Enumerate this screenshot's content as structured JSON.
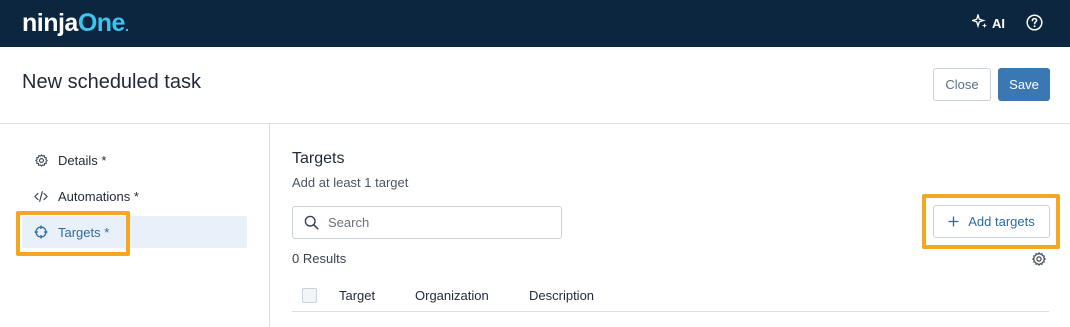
{
  "app": {
    "logo_part1": "ninja",
    "logo_part2": "One",
    "logo_dot": "."
  },
  "topbar": {
    "ai_label": "AI",
    "ai_icon": "sparkle-icon",
    "help_icon": "help-circle-icon"
  },
  "header": {
    "title": "New scheduled task",
    "close_label": "Close",
    "save_label": "Save"
  },
  "sidebar": {
    "items": [
      {
        "label": "Details *",
        "icon": "gear-icon"
      },
      {
        "label": "Automations *",
        "icon": "code-icon"
      },
      {
        "label": "Targets *",
        "icon": "crosshair-icon",
        "active": true
      }
    ]
  },
  "main": {
    "title": "Targets",
    "subtitle": "Add at least 1 target",
    "search_placeholder": "Search",
    "add_targets_label": "Add targets",
    "results_text": "0 Results",
    "columns": [
      "Target",
      "Organization",
      "Description"
    ]
  },
  "colors": {
    "topbar": "#0c2640",
    "accent": "#3a78b4",
    "highlight": "#f5a623",
    "logo_accent": "#3fc3f0"
  }
}
